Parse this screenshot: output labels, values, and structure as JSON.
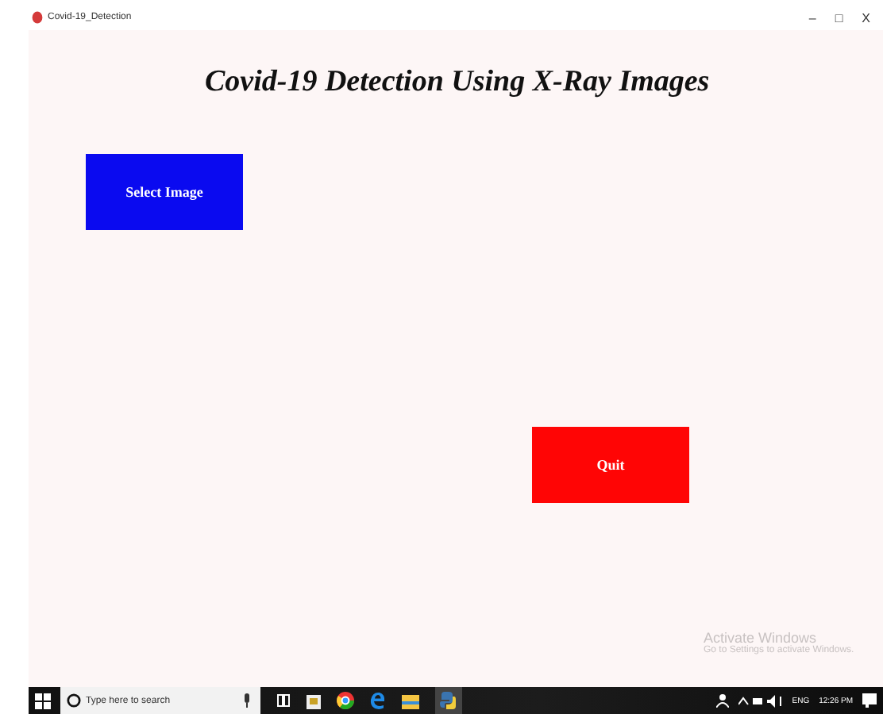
{
  "window": {
    "title": "Covid-19_Detection",
    "controls": [
      "–",
      "□",
      "X"
    ]
  },
  "heading": "Covid-19 Detection Using X-Ray Images",
  "buttons": [
    {
      "label": "Select Image",
      "kind": "select"
    },
    {
      "label": "Quit",
      "kind": "quit"
    }
  ],
  "watermark": {
    "title": "Activate Windows",
    "subtitle": "Go to Settings to activate Windows."
  },
  "taskbar": {
    "search_placeholder": "Type here to search",
    "language": "ENG",
    "time": "12:26 PM"
  }
}
